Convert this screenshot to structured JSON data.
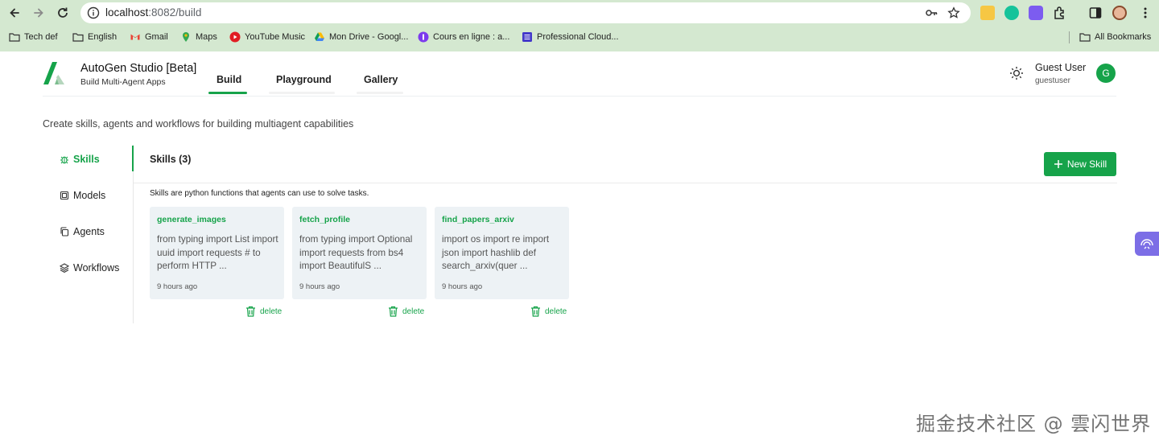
{
  "browser": {
    "url_host": "localhost",
    "url_path": ":8082/build",
    "bookmarks": [
      {
        "label": "Tech def",
        "icon": "folder-icon"
      },
      {
        "label": "English",
        "icon": "folder-icon"
      },
      {
        "label": "Gmail",
        "icon": "gmail-icon"
      },
      {
        "label": "Maps",
        "icon": "maps-icon"
      },
      {
        "label": "YouTube Music",
        "icon": "youtube-music-icon"
      },
      {
        "label": "Mon Drive - Googl...",
        "icon": "drive-icon"
      },
      {
        "label": "Cours en ligne  : a...",
        "icon": "course-icon"
      },
      {
        "label": "Professional Cloud...",
        "icon": "cloud-icon"
      }
    ],
    "all_bookmarks_label": "All Bookmarks"
  },
  "app": {
    "title": "AutoGen Studio [Beta]",
    "subtitle": "Build Multi-Agent Apps",
    "tabs": [
      {
        "label": "Build",
        "active": true
      },
      {
        "label": "Playground",
        "active": false
      },
      {
        "label": "Gallery",
        "active": false
      }
    ],
    "user": {
      "name": "Guest User",
      "id": "guestuser",
      "initial": "G"
    },
    "accent_color": "#16a34a"
  },
  "page": {
    "description": "Create skills, agents and workflows for building multiagent capabilities",
    "sidebar": [
      {
        "label": "Skills",
        "icon": "bug-icon",
        "active": true
      },
      {
        "label": "Models",
        "icon": "cube-icon",
        "active": false
      },
      {
        "label": "Agents",
        "icon": "copy-icon",
        "active": false
      },
      {
        "label": "Workflows",
        "icon": "layers-icon",
        "active": false
      }
    ],
    "section_title": "Skills (3)",
    "new_button_label": "New Skill",
    "section_description": "Skills are python functions that agents can use to solve tasks.",
    "delete_label": "delete",
    "skills": [
      {
        "name": "generate_images",
        "preview": "from typing import List import uuid import requests # to perform HTTP ...",
        "time": "9 hours ago"
      },
      {
        "name": "fetch_profile",
        "preview": "from typing import Optional import requests from bs4 import BeautifulS ...",
        "time": "9 hours ago"
      },
      {
        "name": "find_papers_arxiv",
        "preview": "import os import re import json import hashlib def search_arxiv(quer ...",
        "time": "9 hours ago"
      }
    ]
  },
  "watermark": "掘金技术社区 @ 雲闪世界"
}
